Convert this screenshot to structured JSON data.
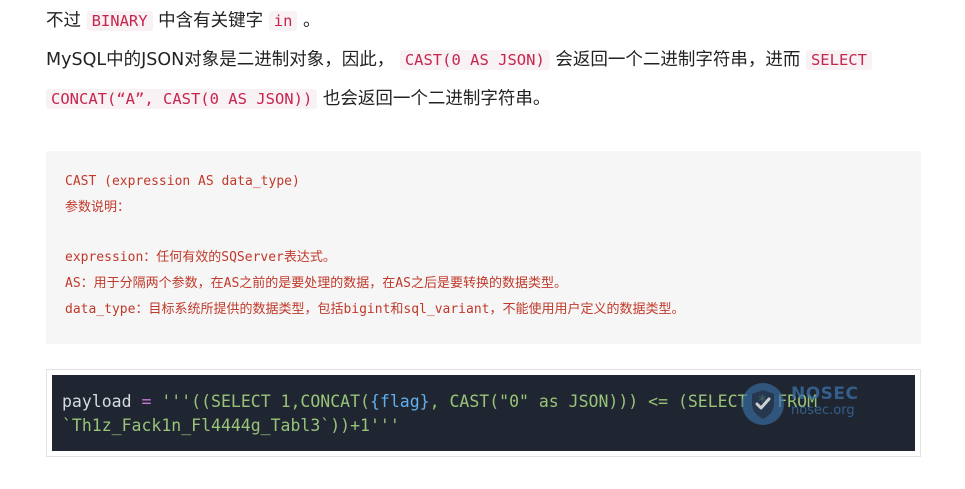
{
  "paragraph1": {
    "text_before": "不过",
    "code_binary": "BINARY",
    "text_middle": "中含有关键字",
    "code_in": "in",
    "text_after": "。"
  },
  "paragraph2": {
    "text_before": "MySQL中的JSON对象是二进制对象，因此，",
    "code_cast": "CAST(0 AS JSON)",
    "text_middle": "会返回一个二进制字符串，进而",
    "code_select": "SELECT"
  },
  "paragraph3": {
    "code_concat": "CONCAT(“A”, CAST(0 AS JSON))",
    "text_after": "也会返回一个二进制字符串。"
  },
  "code_note": {
    "lines": [
      "CAST (expression AS data_type)",
      "参数说明：",
      "expression：任何有效的SQServer表达式。",
      "AS：用于分隔两个参数，在AS之前的是要处理的数据，在AS之后是要转换的数据类型。",
      "data_type：目标系统所提供的数据类型，包括bigint和sql_variant，不能使用用户定义的数据类型。"
    ]
  },
  "screenshot": {
    "var_name": "payload",
    "op_assign": "=",
    "str_open": "'''((SELECT 1,CONCAT(",
    "brace_flag": "{flag}",
    "str_mid": ", CAST(\"0\" as JSON))) <= (SELECT * FROM",
    "line2": "`Th1z_Fack1n_Fl4444g_Tabl3`))+1'''",
    "watermark_title": "NOSEC",
    "watermark_sub": "nosec.org"
  },
  "colors": {
    "inline_code": "#c7254e",
    "note_text": "#c0392b",
    "terminal_bg": "#1f2631"
  }
}
